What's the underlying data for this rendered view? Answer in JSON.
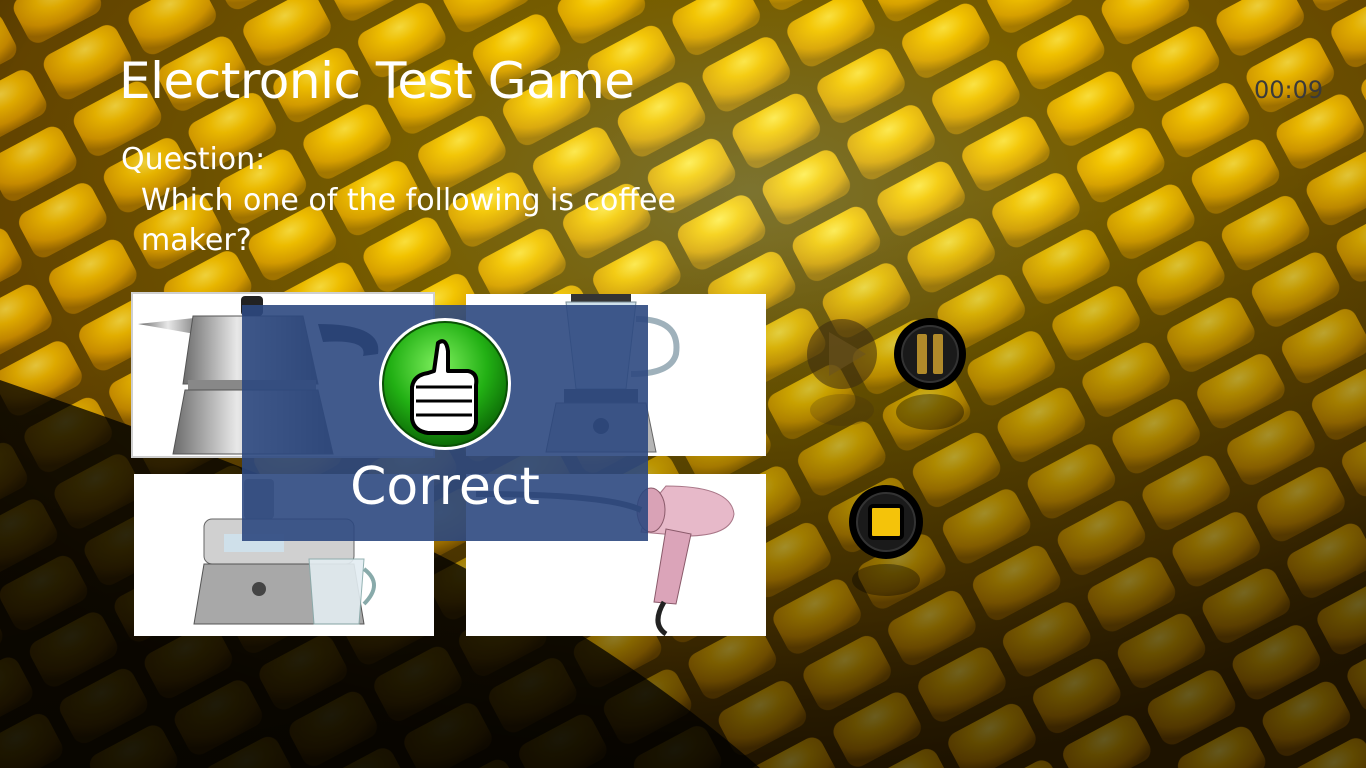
{
  "app": {
    "title": "Electronic Test Game",
    "timer": "00:09"
  },
  "question": {
    "label": "Question:",
    "text": "Which one of the following is coffee maker?"
  },
  "answers": [
    {
      "item": "moka-pot",
      "icon": "moka-pot-image"
    },
    {
      "item": "blender",
      "icon": "blender-image"
    },
    {
      "item": "juicer",
      "icon": "juicer-image"
    },
    {
      "item": "hair-dryer",
      "icon": "hair-dryer-image"
    }
  ],
  "result": {
    "text": "Correct",
    "icon": "thumbs-up-icon"
  },
  "controls": {
    "play_icon": "play-icon",
    "pause_icon": "pause-icon",
    "stop_icon": "stop-icon"
  },
  "colors": {
    "overlay": "#2c4880",
    "accent_yellow": "#f2c100",
    "badge_green": "#22b014"
  }
}
